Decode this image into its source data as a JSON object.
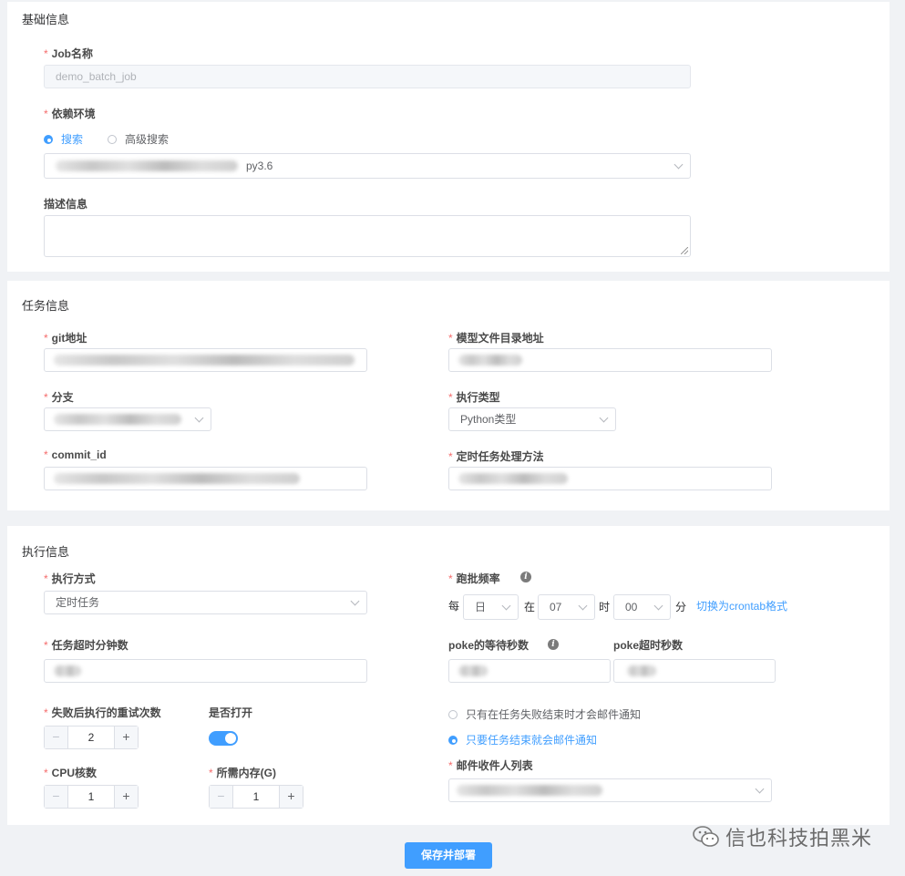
{
  "basic": {
    "title": "基础信息",
    "job_name_label": "Job名称",
    "job_name_value": "demo_batch_job",
    "env_label": "依赖环境",
    "radio_search": "搜索",
    "radio_advanced": "高级搜索",
    "env_value_suffix": "py3.6",
    "desc_label": "描述信息"
  },
  "task": {
    "title": "任务信息",
    "git_label": "git地址",
    "model_dir_label": "模型文件目录地址",
    "branch_label": "分支",
    "exec_type_label": "执行类型",
    "exec_type_value": "Python类型",
    "commit_label": "commit_id",
    "cron_method_label": "定时任务处理方法"
  },
  "exec": {
    "title": "执行信息",
    "mode_label": "执行方式",
    "mode_value": "定时任务",
    "freq_label": "跑批频率",
    "freq_every": "每",
    "freq_unit": "日",
    "freq_at": "在",
    "freq_hour": "07",
    "freq_hour_word": "时",
    "freq_minute": "00",
    "freq_minute_word": "分",
    "crontab_link": "切换为crontab格式",
    "timeout_label": "任务超时分钟数",
    "poke_wait_label": "poke的等待秒数",
    "poke_timeout_label": "poke超时秒数",
    "retry_label": "失败后执行的重试次数",
    "retry_value": "2",
    "open_label": "是否打开",
    "notify_fail_only": "只有在任务失败结束时才会邮件通知",
    "notify_any_end": "只要任务结束就会邮件通知",
    "cpu_label": "CPU核数",
    "cpu_value": "1",
    "mem_label": "所需内存(G)",
    "mem_value": "1",
    "mail_label": "邮件收件人列表"
  },
  "footer": {
    "submit": "保存并部署",
    "watermark": "信也科技拍黑米"
  },
  "colors": {
    "primary": "#409eff",
    "required": "#f56c6c"
  }
}
